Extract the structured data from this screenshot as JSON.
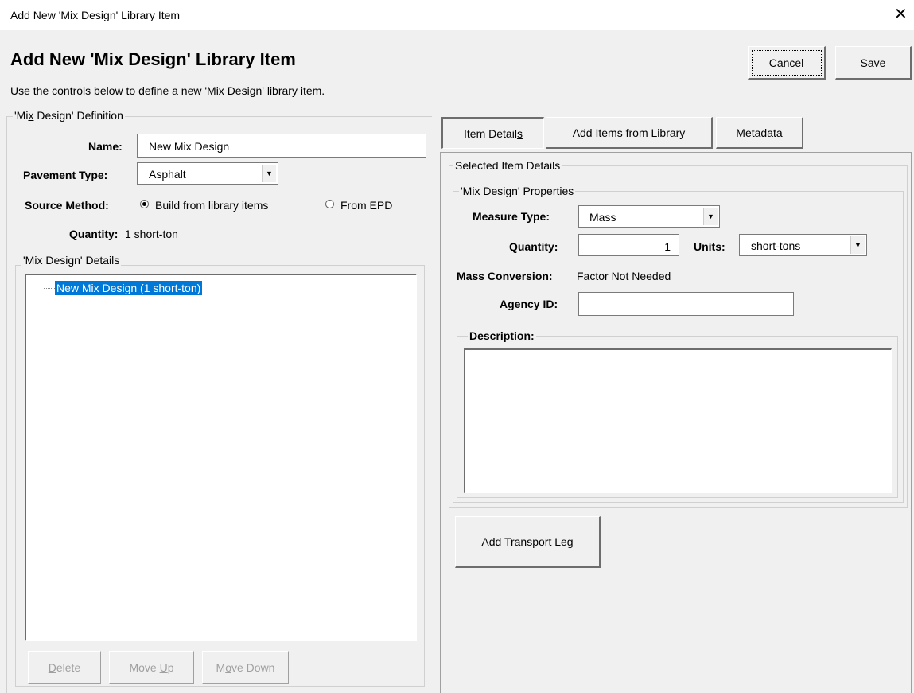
{
  "window": {
    "title": "Add New 'Mix Design' Library Item",
    "close_glyph": "✕"
  },
  "header": {
    "title": "Add New 'Mix Design' Library Item",
    "subtitle": "Use the controls below to define a new 'Mix Design' library item.",
    "cancel": {
      "pre": "",
      "u": "C",
      "post": "ancel"
    },
    "save": {
      "pre": "Sa",
      "u": "v",
      "post": "e"
    }
  },
  "definition": {
    "group_label": {
      "pre": "'Mi",
      "u": "x",
      "post": " Design' Definition"
    },
    "name_label": "Name:",
    "name_value": "New Mix Design",
    "pavement_label": "Pavement Type:",
    "pavement_value": "Asphalt",
    "source_label": "Source Method:",
    "source_options": [
      "Build from library items",
      "From EPD"
    ],
    "quantity_label": "Quantity:",
    "quantity_value": "1 short-ton"
  },
  "details": {
    "group_label": "'Mix Design' Details",
    "tree_item": "New Mix Design (1 short-ton)",
    "delete": {
      "pre": "",
      "u": "D",
      "post": "elete"
    },
    "move_up": {
      "pre": "Move ",
      "u": "U",
      "post": "p"
    },
    "move_down": {
      "pre": "M",
      "u": "o",
      "post": "ve Down"
    }
  },
  "tabs": {
    "item_details": {
      "pre": "Item Detail",
      "u": "s",
      "post": ""
    },
    "add_items": {
      "pre": "Add Items from ",
      "u": "L",
      "post": "ibrary"
    },
    "metadata": {
      "pre": "",
      "u": "M",
      "post": "etadata"
    }
  },
  "selected": {
    "group_label": "Selected Item Details",
    "props_label": "'Mix Design' Properties",
    "measure_label": "Measure Type:",
    "measure_value": "Mass",
    "quantity_label": "Quantity:",
    "quantity_value": "1",
    "units_label": "Units:",
    "units_value": "short-tons",
    "mass_conv_label": "Mass Conversion:",
    "mass_conv_value": "Factor Not Needed",
    "agency_label": "Agency ID:",
    "agency_value": "",
    "description_label": "Description:",
    "description_value": "",
    "add_transport": {
      "pre": "Add ",
      "u": "T",
      "post": "ransport Leg"
    }
  },
  "colors": {
    "selection": "#0078d7",
    "window_bg": "#f0f0f0"
  }
}
